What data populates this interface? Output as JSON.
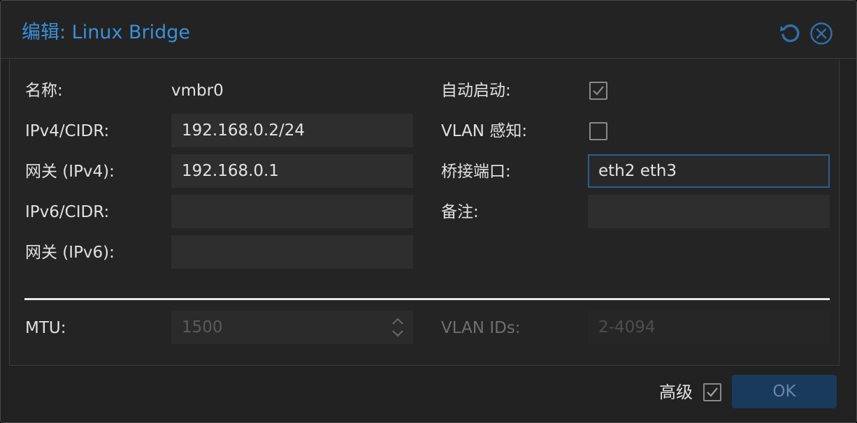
{
  "dialog": {
    "title": "编辑: Linux Bridge"
  },
  "form": {
    "name": {
      "label": "名称:",
      "value": "vmbr0"
    },
    "ipv4_cidr": {
      "label": "IPv4/CIDR:",
      "value": "192.168.0.2/24"
    },
    "gateway_ipv4": {
      "label": "网关 (IPv4):",
      "value": "192.168.0.1"
    },
    "ipv6_cidr": {
      "label": "IPv6/CIDR:",
      "value": ""
    },
    "gateway_ipv6": {
      "label": "网关 (IPv6):",
      "value": ""
    },
    "autostart": {
      "label": "自动启动:",
      "checked": true
    },
    "vlan_aware": {
      "label": "VLAN 感知:",
      "checked": false
    },
    "bridge_ports": {
      "label": "桥接端口:",
      "value": "eth2 eth3"
    },
    "comment": {
      "label": "备注:",
      "value": ""
    },
    "mtu": {
      "label": "MTU:",
      "placeholder": "1500"
    },
    "vlan_ids": {
      "label": "VLAN IDs:",
      "placeholder": "2-4094"
    }
  },
  "footer": {
    "advanced_label": "高级",
    "advanced_checked": true,
    "ok_label": "OK"
  },
  "colors": {
    "accent": "#3b8fd9",
    "ok_button": "#1a3a5c",
    "focus_border": "#2c5f91"
  },
  "icons": {
    "reset": "undo-icon",
    "close": "close-circle-icon",
    "check": "checkmark-icon",
    "spinner": "spinner-arrows-icon"
  }
}
